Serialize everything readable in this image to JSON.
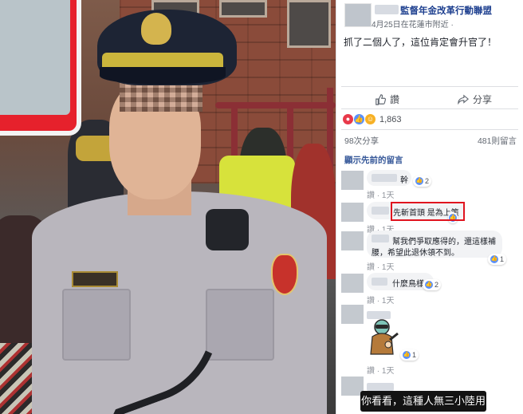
{
  "post": {
    "page_name": "監督年金改革行動聯盟",
    "meta": "4月25日在花蓮市附近 ·",
    "text": "抓了二個人了，這位肯定會升官了！",
    "actions": {
      "like": "讚",
      "share": "分享"
    },
    "reaction_count": "1,863",
    "shares": "98次分享",
    "comments_count": "481則留言",
    "view_earlier": "顯示先前的留言"
  },
  "comments": [
    {
      "text": "幹",
      "likes": "2",
      "time": "讚 · 1天"
    },
    {
      "text": "先斬首頭 是為上策",
      "likes": "",
      "time": "讚 · 1天"
    },
    {
      "text_line1": "幫我們爭取應得的，還這樣補",
      "text_line2": "腰，希望此退休領不到。",
      "likes": "1",
      "time": "讚 · 1天"
    },
    {
      "text": "什麼鳥樣",
      "likes": "2",
      "time": "讚 · 1天"
    },
    {
      "text": "",
      "likes": "1",
      "time": "讚 · 1天"
    },
    {
      "text": "",
      "likes": "",
      "time": ""
    }
  ],
  "caption": "你看看，這種人無三小陸用",
  "colors": {
    "link": "#365899",
    "name": "#1d3f8f",
    "highlight": "#e0141f",
    "like": "#5890ff"
  },
  "icons": [
    "like-icon",
    "share-icon",
    "like-reaction-icon",
    "haha-reaction-icon"
  ]
}
